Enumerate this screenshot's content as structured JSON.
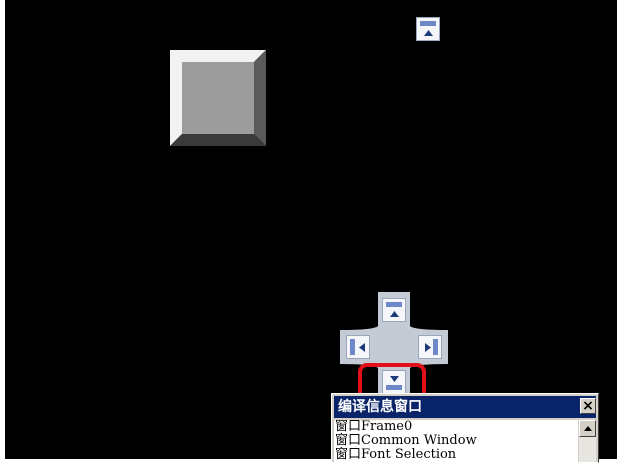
{
  "colors": {
    "canvas_bg": "#000000",
    "dock_band": "#6e88c8",
    "highlight": "#e3101a",
    "title_bar": "#0a246a"
  },
  "dock_guide": {
    "top_arrow_icon": "dock-up-icon",
    "center_up_icon": "dock-up-icon",
    "left_icon": "dock-left-icon",
    "right_icon": "dock-right-icon",
    "down_icon": "dock-down-icon"
  },
  "info_window": {
    "title": "编译信息窗口",
    "close_label": "×",
    "lines": [
      "窗口Frame0",
      "窗口Common Window",
      "窗口Font Selection"
    ]
  }
}
